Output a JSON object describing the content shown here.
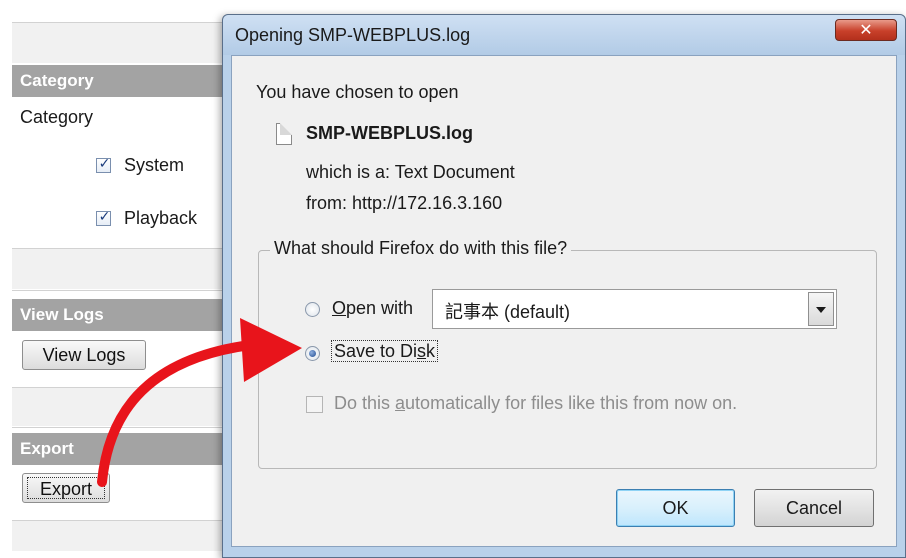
{
  "left_panel": {
    "category_header": "Category",
    "category_label": "Category",
    "checkboxes": [
      {
        "label": "System",
        "checked": true
      },
      {
        "label": "Playback",
        "checked": true
      }
    ],
    "view_logs_header": "View Logs",
    "view_logs_button": "View Logs",
    "export_header": "Export",
    "export_button": "Export"
  },
  "dialog": {
    "title": "Opening SMP-WEBPLUS.log",
    "close_glyph": "✕",
    "intro": "You have chosen to open",
    "file_name": "SMP-WEBPLUS.log",
    "which_is_prefix": "which is a:",
    "which_is_value": "Text Document",
    "from_prefix": "from:",
    "from_value": "http://172.16.3.160",
    "group_title": "What should Firefox do with this file?",
    "open_with": {
      "label_accel": "O",
      "label_rest": "pen with",
      "selected": false,
      "app_value": "記事本 (default)"
    },
    "save_to_disk": {
      "label_before": "Save to Di",
      "label_accel": "s",
      "label_after": "k",
      "selected": true
    },
    "auto_checkbox": {
      "label_before": "Do this ",
      "label_accel": "a",
      "label_after": "utomatically for files like this from now on.",
      "checked": false,
      "enabled": false
    },
    "ok_button": "OK",
    "cancel_button": "Cancel"
  },
  "colors": {
    "annotation_arrow": "#e8141b",
    "section_header_bg": "#a3a3a3",
    "dialog_frame": "#b9d1ea",
    "close_button": "#c8402a"
  }
}
